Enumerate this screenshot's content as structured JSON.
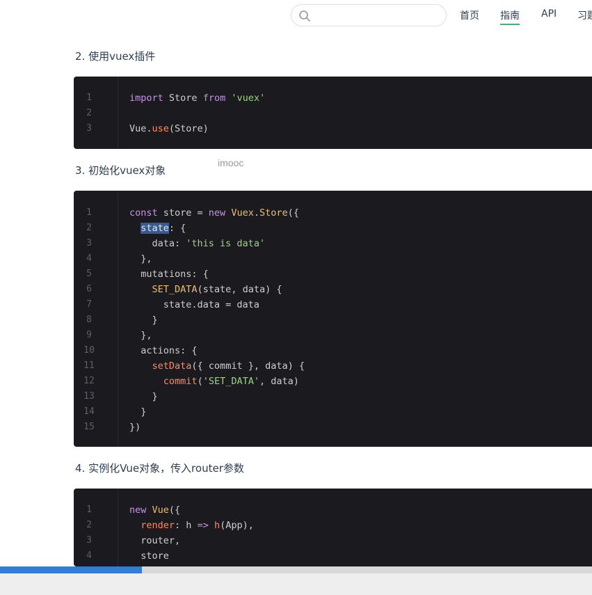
{
  "nav": {
    "search_placeholder": "",
    "items": [
      "首页",
      "指南",
      "API",
      "习题"
    ],
    "active": "指南"
  },
  "sections": [
    {
      "heading": "2. 使用vuex插件",
      "lines": [
        {
          "n": "1",
          "tokens": [
            [
              "k",
              "import"
            ],
            [
              "p",
              " Store "
            ],
            [
              "k",
              "from"
            ],
            [
              "p",
              " "
            ],
            [
              "s",
              "'vuex'"
            ]
          ]
        },
        {
          "n": "2",
          "tokens": []
        },
        {
          "n": "3",
          "tokens": [
            [
              "p",
              "Vue."
            ],
            [
              "f",
              "use"
            ],
            [
              "p",
              "(Store)"
            ]
          ]
        }
      ]
    },
    {
      "heading": "3. 初始化vuex对象",
      "lines": [
        {
          "n": "1",
          "tokens": [
            [
              "k",
              "const"
            ],
            [
              "p",
              " store = "
            ],
            [
              "k",
              "new"
            ],
            [
              "p",
              " "
            ],
            [
              "y",
              "Vuex"
            ],
            [
              "p",
              "."
            ],
            [
              "y",
              "Store"
            ],
            [
              "p",
              "({"
            ]
          ]
        },
        {
          "n": "2",
          "tokens": [
            [
              "p",
              "  "
            ],
            [
              "sel",
              "state"
            ],
            [
              "p",
              ": {"
            ]
          ]
        },
        {
          "n": "3",
          "tokens": [
            [
              "p",
              "    data: "
            ],
            [
              "s",
              "'this is data'"
            ]
          ]
        },
        {
          "n": "4",
          "tokens": [
            [
              "p",
              "  },"
            ]
          ]
        },
        {
          "n": "5",
          "tokens": [
            [
              "p",
              "  mutations: {"
            ]
          ]
        },
        {
          "n": "6",
          "tokens": [
            [
              "p",
              "    "
            ],
            [
              "y",
              "SET_DATA"
            ],
            [
              "p",
              "(state, data) {"
            ]
          ]
        },
        {
          "n": "7",
          "tokens": [
            [
              "p",
              "      state.data = data"
            ]
          ]
        },
        {
          "n": "8",
          "tokens": [
            [
              "p",
              "    }"
            ]
          ]
        },
        {
          "n": "9",
          "tokens": [
            [
              "p",
              "  },"
            ]
          ]
        },
        {
          "n": "10",
          "tokens": [
            [
              "p",
              "  actions: {"
            ]
          ]
        },
        {
          "n": "11",
          "tokens": [
            [
              "p",
              "    "
            ],
            [
              "f",
              "setData"
            ],
            [
              "p",
              "({ commit }, data) {"
            ]
          ]
        },
        {
          "n": "12",
          "tokens": [
            [
              "p",
              "      "
            ],
            [
              "f",
              "commit"
            ],
            [
              "p",
              "("
            ],
            [
              "s",
              "'SET_DATA'"
            ],
            [
              "p",
              ", data)"
            ]
          ]
        },
        {
          "n": "13",
          "tokens": [
            [
              "p",
              "    }"
            ]
          ]
        },
        {
          "n": "14",
          "tokens": [
            [
              "p",
              "  }"
            ]
          ]
        },
        {
          "n": "15",
          "tokens": [
            [
              "p",
              "})"
            ]
          ]
        }
      ]
    },
    {
      "heading": "4. 实例化Vue对象，传入router参数",
      "lines": [
        {
          "n": "1",
          "tokens": [
            [
              "k",
              "new"
            ],
            [
              "p",
              " "
            ],
            [
              "y",
              "Vue"
            ],
            [
              "p",
              "({"
            ]
          ]
        },
        {
          "n": "2",
          "tokens": [
            [
              "p",
              "  "
            ],
            [
              "f",
              "render"
            ],
            [
              "p",
              ": h "
            ],
            [
              "k",
              "=>"
            ],
            [
              "p",
              " "
            ],
            [
              "f",
              "h"
            ],
            [
              "p",
              "(App),"
            ]
          ]
        },
        {
          "n": "3",
          "tokens": [
            [
              "p",
              "  router,"
            ]
          ]
        },
        {
          "n": "4",
          "tokens": [
            [
              "p",
              "  store"
            ]
          ]
        }
      ]
    }
  ],
  "watermark": "imooc",
  "video": {
    "progress": 0.24
  },
  "colors": {
    "accent": "#3eaf7c",
    "code_bg": "#1b1b1f",
    "progress": "#2f7fd8"
  }
}
